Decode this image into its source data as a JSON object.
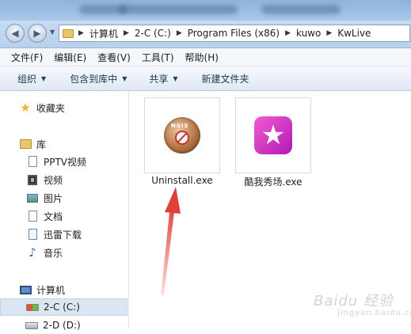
{
  "address": {
    "breadcrumb": [
      "计算机",
      "2-C (C:)",
      "Program Files (x86)",
      "kuwo",
      "KwLive"
    ]
  },
  "menu": [
    "文件(F)",
    "编辑(E)",
    "查看(V)",
    "工具(T)",
    "帮助(H)"
  ],
  "toolbar": {
    "organize": "组织",
    "include_in_library": "包含到库中",
    "share": "共享",
    "new_folder": "新建文件夹"
  },
  "sidebar": {
    "favorites": "收藏夹",
    "libraries": "库",
    "library_items": [
      "PPTV视频",
      "视频",
      "图片",
      "文档",
      "迅雷下载",
      "音乐"
    ],
    "computer": "计算机",
    "drives": [
      "2-C (C:)",
      "2-D (D:)"
    ]
  },
  "files": [
    {
      "name": "Uninstall.exe",
      "icon": "uninstall-icon"
    },
    {
      "name": "酷我秀场.exe",
      "icon": "kuwo-show-icon"
    }
  ],
  "annotation_color": "#e0403a",
  "watermark": {
    "text": "Baidu 经验",
    "sub": "jingyan.baidu.com"
  }
}
